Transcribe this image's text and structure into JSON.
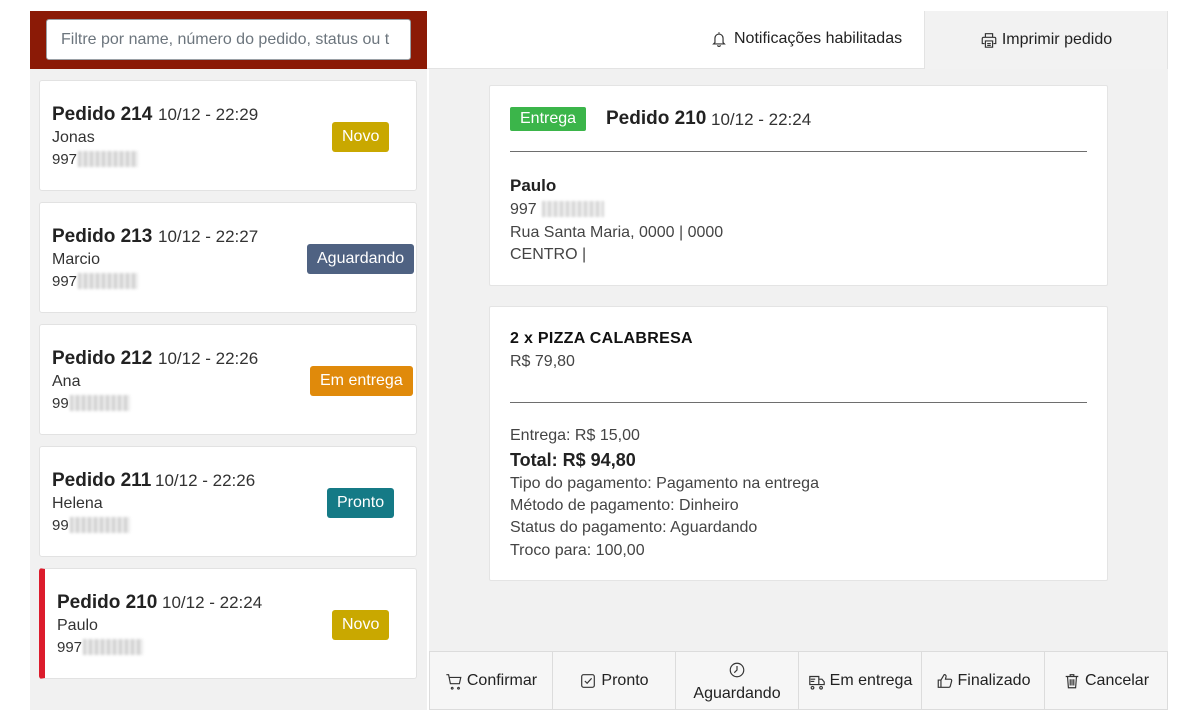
{
  "search": {
    "placeholder": "Filtre por name, número do pedido, status ou t"
  },
  "header": {
    "notifications_label": "Notificações habilitadas",
    "print_label": "Imprimir pedido"
  },
  "orders": [
    {
      "title": "Pedido 214",
      "time": "10/12 - 22:29",
      "name": "Jonas",
      "phone": "997",
      "status": "Novo",
      "status_color": "#c9a800"
    },
    {
      "title": "Pedido 213",
      "time": "10/12 - 22:27",
      "name": "Marcio",
      "phone": "997",
      "status": "Aguardando",
      "status_color": "#4f6282"
    },
    {
      "title": "Pedido 212",
      "time": "10/12 - 22:26",
      "name": "Ana",
      "phone": "99",
      "status": "Em entrega",
      "status_color": "#e08a0b"
    },
    {
      "title": "Pedido 211",
      "time": "10/12 - 22:26",
      "name": "Helena",
      "phone": "99",
      "status": "Pronto",
      "status_color": "#157a86"
    },
    {
      "title": "Pedido 210",
      "time": "10/12 - 22:24",
      "name": "Paulo",
      "phone": "997",
      "status": "Novo",
      "status_color": "#c9a800"
    }
  ],
  "detail": {
    "type_badge": "Entrega",
    "type_color": "#3bb54a",
    "title": "Pedido 210",
    "time": "10/12 - 22:24",
    "customer_name": "Paulo",
    "customer_phone": "997",
    "address": "Rua Santa Maria, 0000 | 0000",
    "district": "CENTRO |",
    "item_title": "2 x PIZZA CALABRESA",
    "item_price": "R$ 79,80",
    "delivery_fee": "Entrega: R$ 15,00",
    "total": "Total: R$ 94,80",
    "payment_type": "Tipo do pagamento: Pagamento na entrega",
    "payment_method": "Método de pagamento: Dinheiro",
    "payment_status": "Status do pagamento: Aguardando",
    "change_for": "Troco para: 100,00"
  },
  "actions": [
    {
      "label": "Confirmar",
      "icon": "cart-icon"
    },
    {
      "label": "Pronto",
      "icon": "checkbox-icon"
    },
    {
      "label": "Aguardando",
      "icon": "clock-icon"
    },
    {
      "label": "Em entrega",
      "icon": "truck-icon"
    },
    {
      "label": "Finalizado",
      "icon": "thumbs-up-icon"
    },
    {
      "label": "Cancelar",
      "icon": "trash-icon"
    }
  ]
}
